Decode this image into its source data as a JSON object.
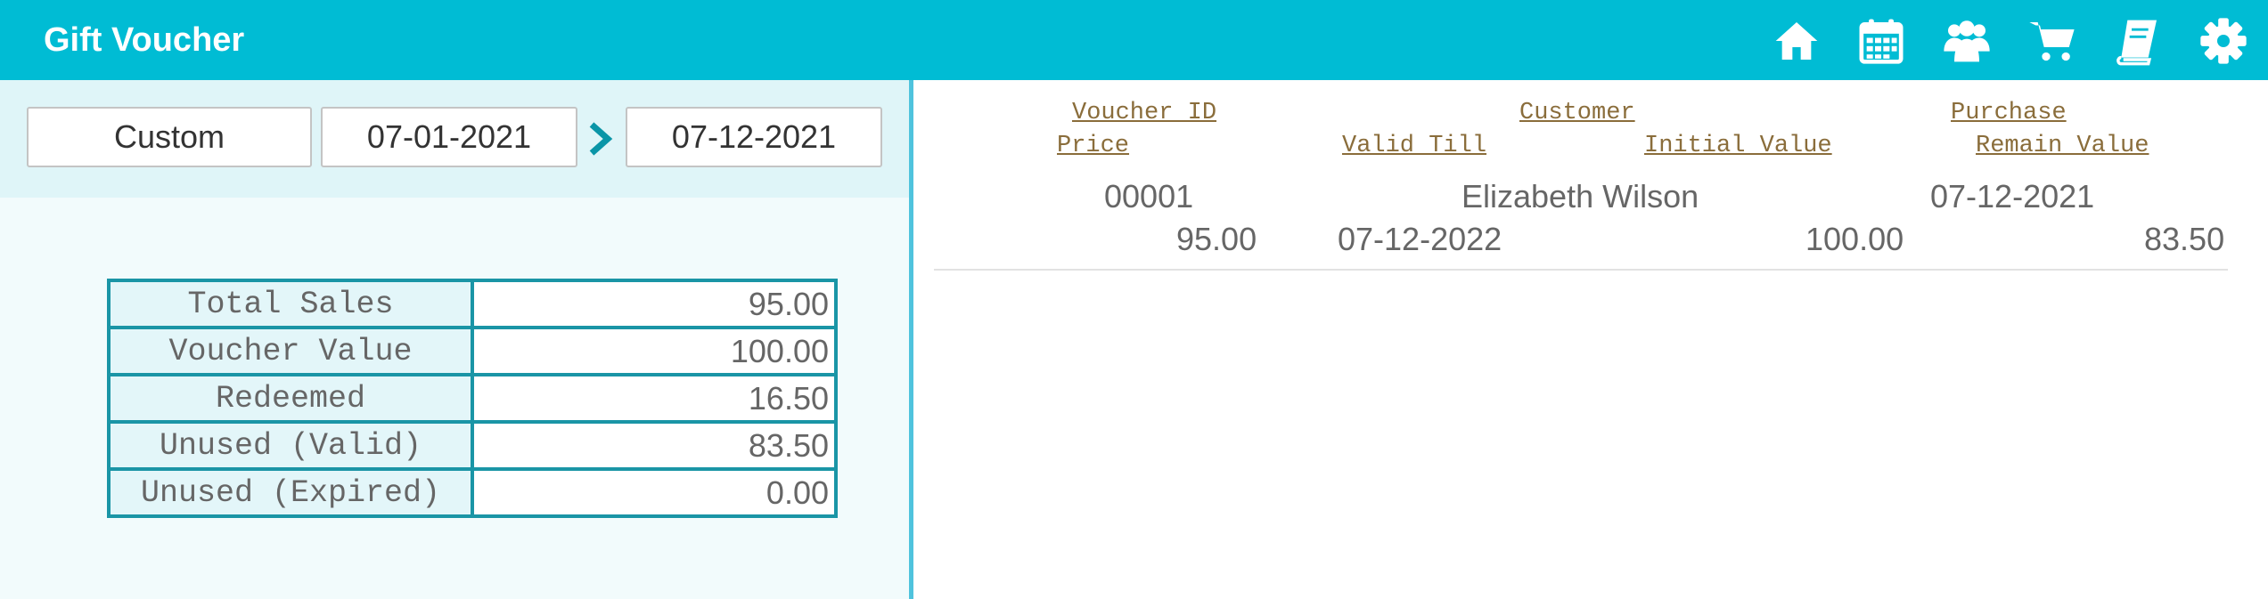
{
  "header": {
    "title": "Gift Voucher",
    "icons": [
      "home-icon",
      "calendar-icon",
      "customers-icon",
      "cart-icon",
      "book-icon",
      "gear-icon"
    ]
  },
  "filter": {
    "period": "Custom",
    "start_date": "07-01-2021",
    "end_date": "07-12-2021"
  },
  "summary": [
    {
      "label": "Total Sales",
      "value": "95.00"
    },
    {
      "label": "Voucher Value",
      "value": "100.00"
    },
    {
      "label": "Redeemed",
      "value": "16.50"
    },
    {
      "label": "Unused (Valid)",
      "value": "83.50"
    },
    {
      "label": "Unused (Expired)",
      "value": "0.00"
    }
  ],
  "list": {
    "headers": {
      "voucher_id": "Voucher ID",
      "customer": "Customer",
      "purchase": "Purchase",
      "price": "Price",
      "valid_till": "Valid Till",
      "initial_value": "Initial Value",
      "remain_value": "Remain Value"
    },
    "rows": [
      {
        "voucher_id": "00001",
        "customer": "Elizabeth Wilson",
        "purchase": "07-12-2021",
        "price": "95.00",
        "valid_till": "07-12-2022",
        "initial_value": "100.00",
        "remain_value": "83.50"
      }
    ]
  },
  "colors": {
    "accent": "#00bcd4",
    "table_border": "#1a95a6",
    "header_link": "#8a6d3b"
  }
}
